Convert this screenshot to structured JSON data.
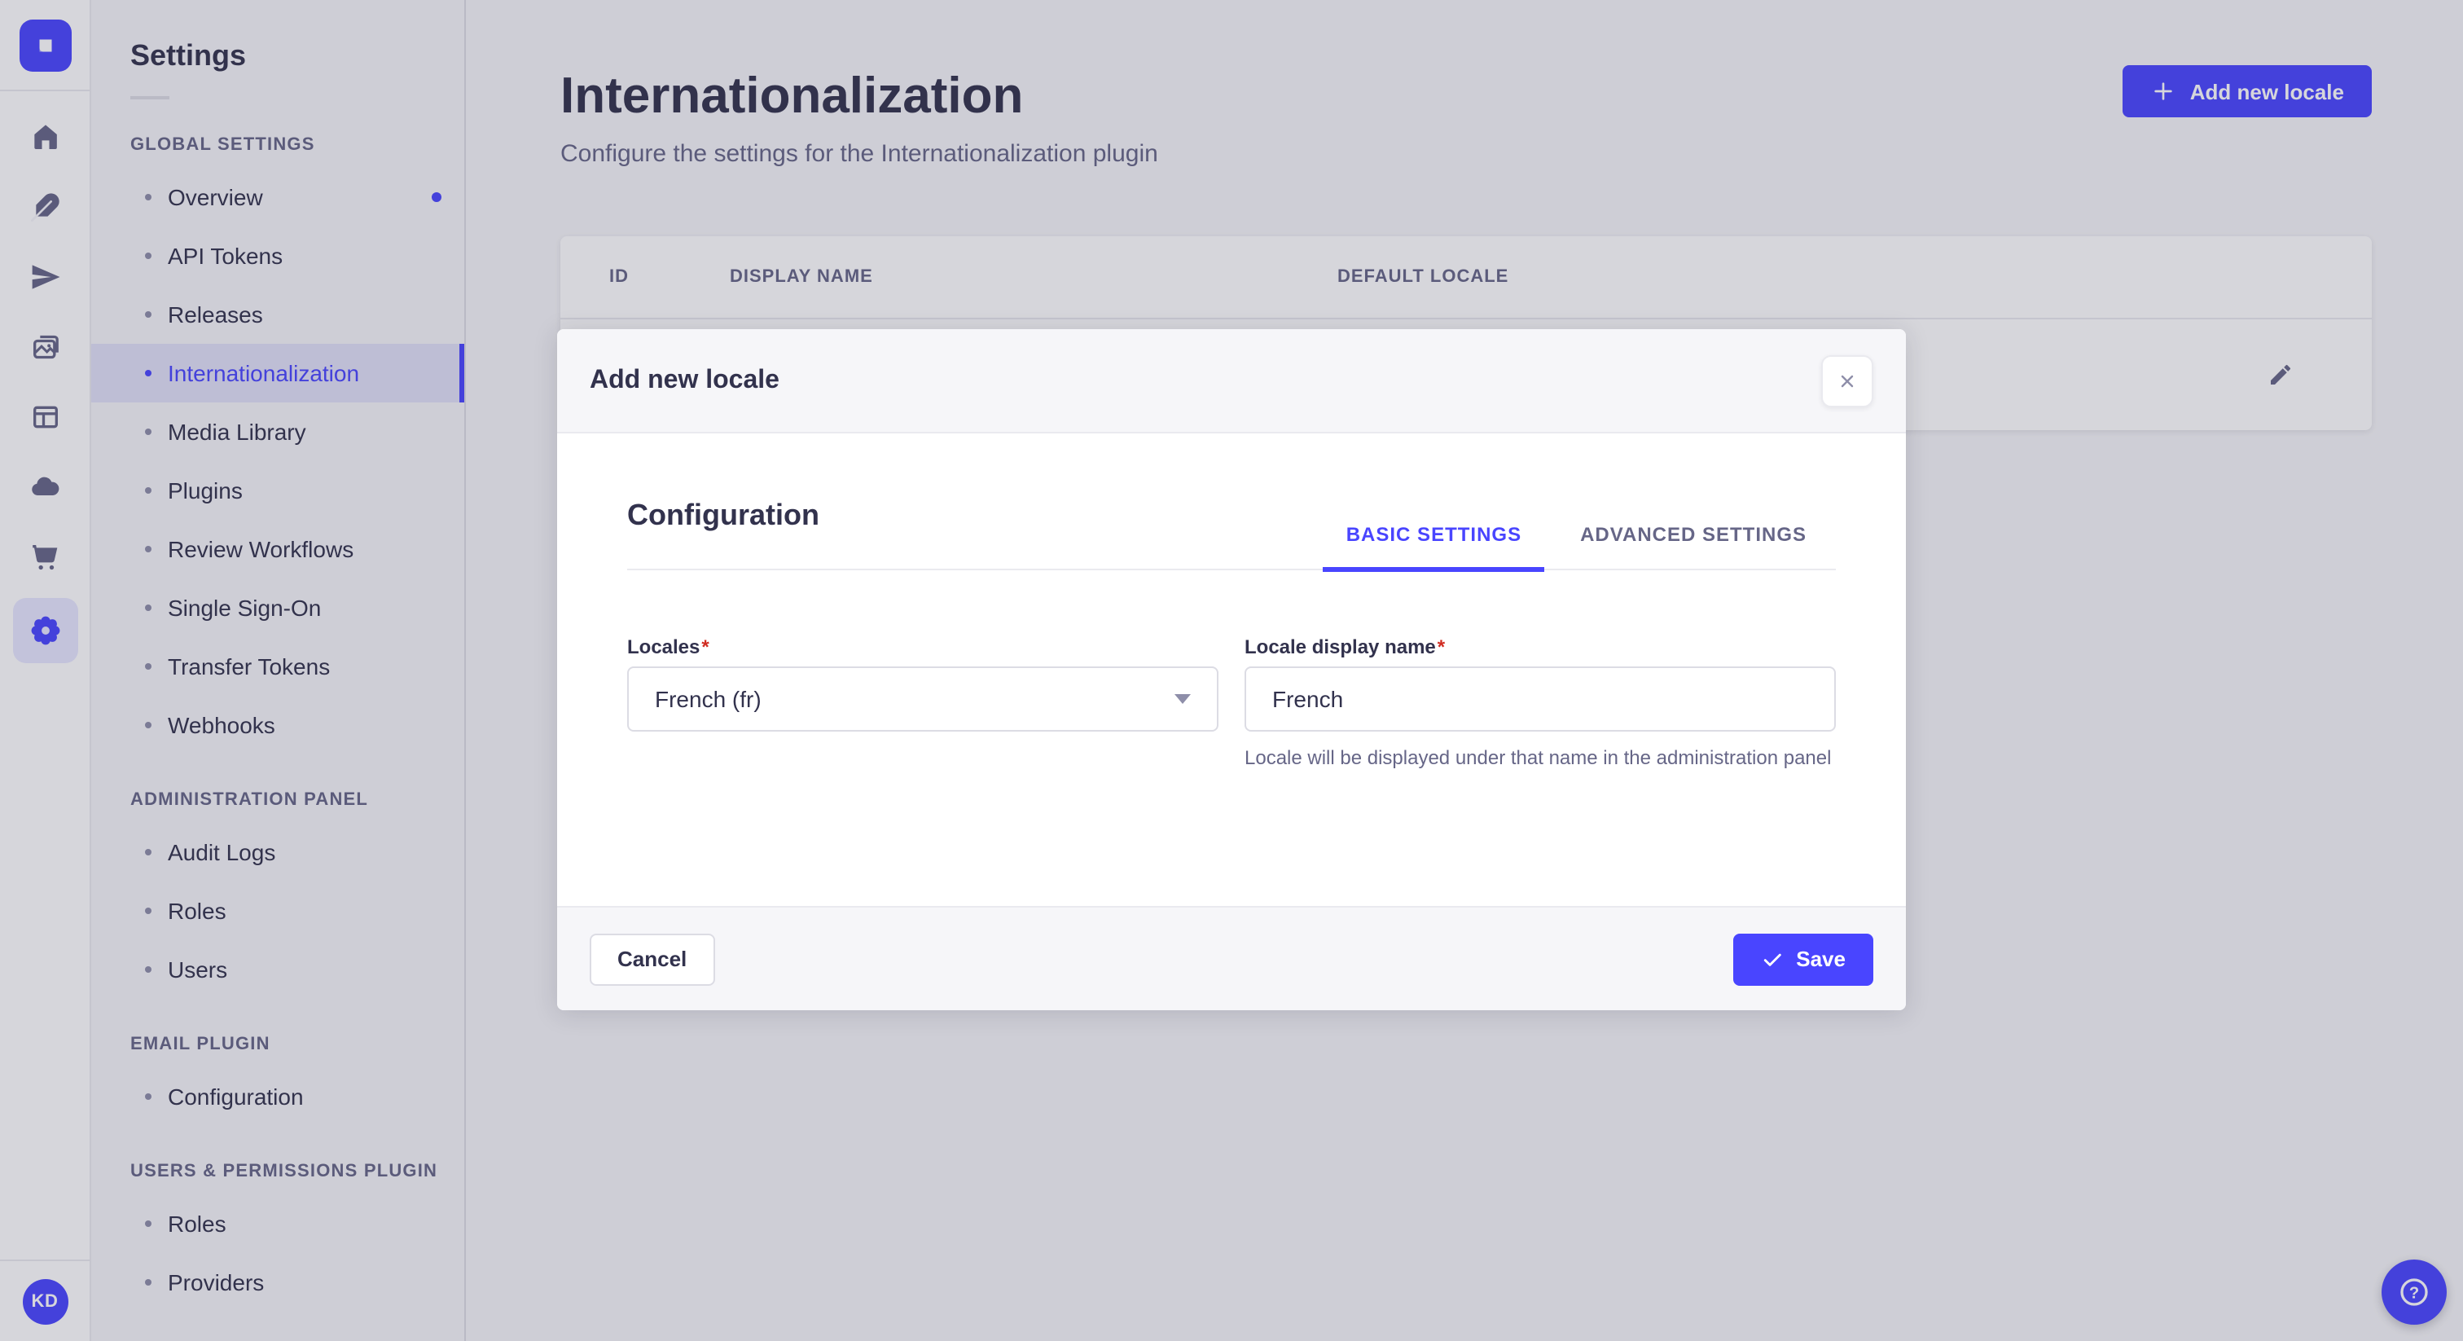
{
  "colors": {
    "accent": "#4945ff",
    "text": "#32324d",
    "muted": "#666687",
    "danger": "#d02b20",
    "active_bg": "#e2e1f8"
  },
  "rail": {
    "avatar_initials": "KD",
    "icons": [
      "strapi-logo",
      "home",
      "feather",
      "paper-plane",
      "media-images",
      "layout",
      "cloud",
      "shopping-cart",
      "gear-active",
      "help-question"
    ]
  },
  "sidebar": {
    "title": "Settings",
    "sections": [
      {
        "header": "GLOBAL SETTINGS",
        "items": [
          {
            "label": "Overview",
            "has_notification_dot": true
          },
          {
            "label": "API Tokens"
          },
          {
            "label": "Releases"
          },
          {
            "label": "Internationalization",
            "active": true
          },
          {
            "label": "Media Library"
          },
          {
            "label": "Plugins"
          },
          {
            "label": "Review Workflows"
          },
          {
            "label": "Single Sign-On"
          },
          {
            "label": "Transfer Tokens"
          },
          {
            "label": "Webhooks"
          }
        ]
      },
      {
        "header": "ADMINISTRATION PANEL",
        "items": [
          {
            "label": "Audit Logs"
          },
          {
            "label": "Roles"
          },
          {
            "label": "Users"
          }
        ]
      },
      {
        "header": "EMAIL PLUGIN",
        "items": [
          {
            "label": "Configuration"
          }
        ]
      },
      {
        "header": "USERS & PERMISSIONS PLUGIN",
        "items": [
          {
            "label": "Roles"
          },
          {
            "label": "Providers"
          }
        ]
      }
    ]
  },
  "header": {
    "title": "Internationalization",
    "subtitle": "Configure the settings for the Internationalization plugin",
    "add_button_label": "Add new locale"
  },
  "table": {
    "columns": [
      "ID",
      "DISPLAY NAME",
      "DEFAULT LOCALE"
    ]
  },
  "modal": {
    "title": "Add new locale",
    "section_title": "Configuration",
    "tabs": [
      {
        "label": "BASIC SETTINGS",
        "active": true
      },
      {
        "label": "ADVANCED SETTINGS",
        "active": false
      }
    ],
    "required_mark": "*",
    "fields": {
      "locales": {
        "label": "Locales",
        "value": "French (fr)"
      },
      "display_name": {
        "label": "Locale display name",
        "value": "French",
        "hint": "Locale will be displayed under that name in the administration panel"
      }
    },
    "cancel_label": "Cancel",
    "save_label": "Save"
  }
}
